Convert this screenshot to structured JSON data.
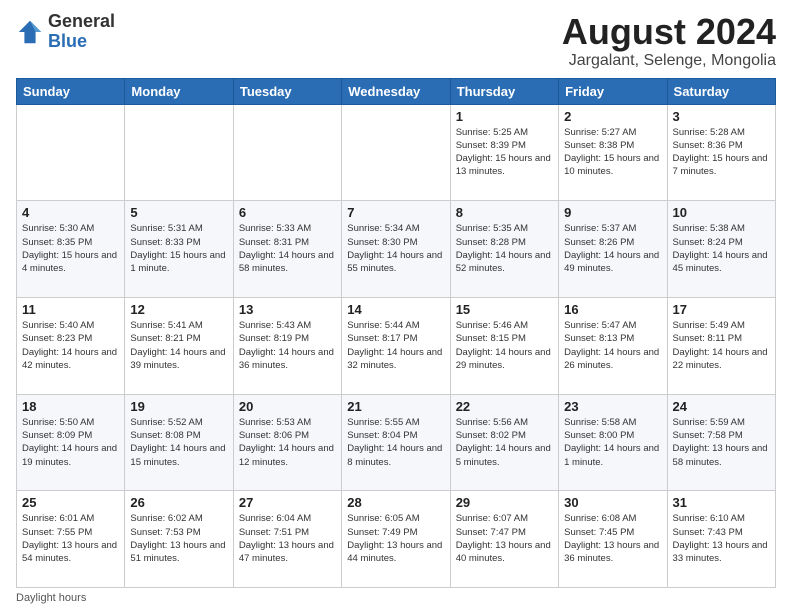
{
  "header": {
    "logo_general": "General",
    "logo_blue": "Blue",
    "month_year": "August 2024",
    "location": "Jargalant, Selenge, Mongolia"
  },
  "weekdays": [
    "Sunday",
    "Monday",
    "Tuesday",
    "Wednesday",
    "Thursday",
    "Friday",
    "Saturday"
  ],
  "weeks": [
    [
      {
        "day": "",
        "info": ""
      },
      {
        "day": "",
        "info": ""
      },
      {
        "day": "",
        "info": ""
      },
      {
        "day": "",
        "info": ""
      },
      {
        "day": "1",
        "info": "Sunrise: 5:25 AM\nSunset: 8:39 PM\nDaylight: 15 hours\nand 13 minutes."
      },
      {
        "day": "2",
        "info": "Sunrise: 5:27 AM\nSunset: 8:38 PM\nDaylight: 15 hours\nand 10 minutes."
      },
      {
        "day": "3",
        "info": "Sunrise: 5:28 AM\nSunset: 8:36 PM\nDaylight: 15 hours\nand 7 minutes."
      }
    ],
    [
      {
        "day": "4",
        "info": "Sunrise: 5:30 AM\nSunset: 8:35 PM\nDaylight: 15 hours\nand 4 minutes."
      },
      {
        "day": "5",
        "info": "Sunrise: 5:31 AM\nSunset: 8:33 PM\nDaylight: 15 hours\nand 1 minute."
      },
      {
        "day": "6",
        "info": "Sunrise: 5:33 AM\nSunset: 8:31 PM\nDaylight: 14 hours\nand 58 minutes."
      },
      {
        "day": "7",
        "info": "Sunrise: 5:34 AM\nSunset: 8:30 PM\nDaylight: 14 hours\nand 55 minutes."
      },
      {
        "day": "8",
        "info": "Sunrise: 5:35 AM\nSunset: 8:28 PM\nDaylight: 14 hours\nand 52 minutes."
      },
      {
        "day": "9",
        "info": "Sunrise: 5:37 AM\nSunset: 8:26 PM\nDaylight: 14 hours\nand 49 minutes."
      },
      {
        "day": "10",
        "info": "Sunrise: 5:38 AM\nSunset: 8:24 PM\nDaylight: 14 hours\nand 45 minutes."
      }
    ],
    [
      {
        "day": "11",
        "info": "Sunrise: 5:40 AM\nSunset: 8:23 PM\nDaylight: 14 hours\nand 42 minutes."
      },
      {
        "day": "12",
        "info": "Sunrise: 5:41 AM\nSunset: 8:21 PM\nDaylight: 14 hours\nand 39 minutes."
      },
      {
        "day": "13",
        "info": "Sunrise: 5:43 AM\nSunset: 8:19 PM\nDaylight: 14 hours\nand 36 minutes."
      },
      {
        "day": "14",
        "info": "Sunrise: 5:44 AM\nSunset: 8:17 PM\nDaylight: 14 hours\nand 32 minutes."
      },
      {
        "day": "15",
        "info": "Sunrise: 5:46 AM\nSunset: 8:15 PM\nDaylight: 14 hours\nand 29 minutes."
      },
      {
        "day": "16",
        "info": "Sunrise: 5:47 AM\nSunset: 8:13 PM\nDaylight: 14 hours\nand 26 minutes."
      },
      {
        "day": "17",
        "info": "Sunrise: 5:49 AM\nSunset: 8:11 PM\nDaylight: 14 hours\nand 22 minutes."
      }
    ],
    [
      {
        "day": "18",
        "info": "Sunrise: 5:50 AM\nSunset: 8:09 PM\nDaylight: 14 hours\nand 19 minutes."
      },
      {
        "day": "19",
        "info": "Sunrise: 5:52 AM\nSunset: 8:08 PM\nDaylight: 14 hours\nand 15 minutes."
      },
      {
        "day": "20",
        "info": "Sunrise: 5:53 AM\nSunset: 8:06 PM\nDaylight: 14 hours\nand 12 minutes."
      },
      {
        "day": "21",
        "info": "Sunrise: 5:55 AM\nSunset: 8:04 PM\nDaylight: 14 hours\nand 8 minutes."
      },
      {
        "day": "22",
        "info": "Sunrise: 5:56 AM\nSunset: 8:02 PM\nDaylight: 14 hours\nand 5 minutes."
      },
      {
        "day": "23",
        "info": "Sunrise: 5:58 AM\nSunset: 8:00 PM\nDaylight: 14 hours\nand 1 minute."
      },
      {
        "day": "24",
        "info": "Sunrise: 5:59 AM\nSunset: 7:58 PM\nDaylight: 13 hours\nand 58 minutes."
      }
    ],
    [
      {
        "day": "25",
        "info": "Sunrise: 6:01 AM\nSunset: 7:55 PM\nDaylight: 13 hours\nand 54 minutes."
      },
      {
        "day": "26",
        "info": "Sunrise: 6:02 AM\nSunset: 7:53 PM\nDaylight: 13 hours\nand 51 minutes."
      },
      {
        "day": "27",
        "info": "Sunrise: 6:04 AM\nSunset: 7:51 PM\nDaylight: 13 hours\nand 47 minutes."
      },
      {
        "day": "28",
        "info": "Sunrise: 6:05 AM\nSunset: 7:49 PM\nDaylight: 13 hours\nand 44 minutes."
      },
      {
        "day": "29",
        "info": "Sunrise: 6:07 AM\nSunset: 7:47 PM\nDaylight: 13 hours\nand 40 minutes."
      },
      {
        "day": "30",
        "info": "Sunrise: 6:08 AM\nSunset: 7:45 PM\nDaylight: 13 hours\nand 36 minutes."
      },
      {
        "day": "31",
        "info": "Sunrise: 6:10 AM\nSunset: 7:43 PM\nDaylight: 13 hours\nand 33 minutes."
      }
    ]
  ],
  "footer": {
    "daylight_label": "Daylight hours"
  }
}
